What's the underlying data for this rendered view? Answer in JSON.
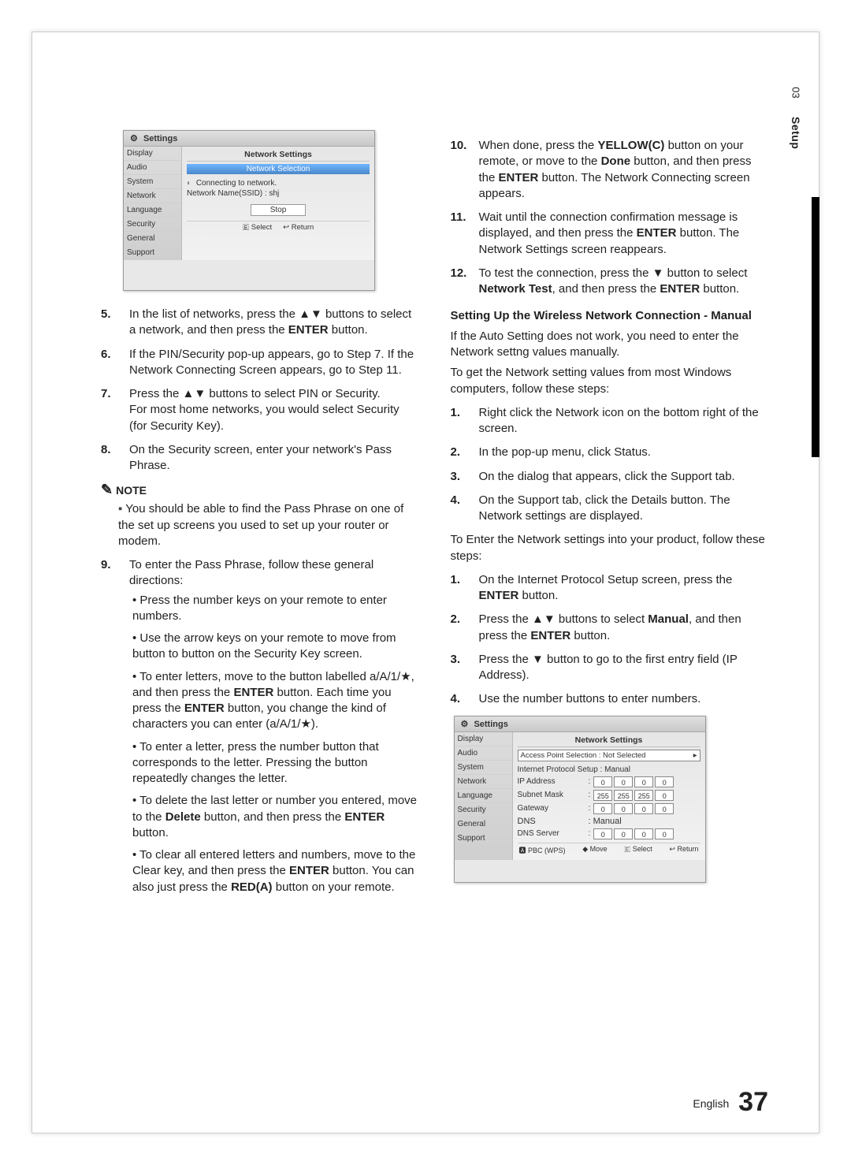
{
  "side": {
    "chapter": "03",
    "title": "Setup"
  },
  "dialog1": {
    "title": "Settings",
    "sidebar": [
      "Display",
      "Audio",
      "System",
      "Network",
      "Language",
      "Security",
      "General",
      "Support"
    ],
    "heading": "Network Settings",
    "sub": "Network Selection",
    "connecting": "Connecting to network.",
    "ssid": "Network Name(SSID)  : shj",
    "stop": "Stop",
    "hint_select": "Select",
    "hint_return": "Return"
  },
  "left_steps_a": [
    {
      "n": "5.",
      "t": "In the list of networks, press the ▲▼ buttons to select a network, and then press the <b>ENTER</b> button."
    },
    {
      "n": "6.",
      "t": "If the PIN/Security pop-up appears, go to Step 7. If the Network Connecting Screen appears, go to Step 11."
    },
    {
      "n": "7.",
      "t": "Press the ▲▼ buttons to select PIN or Security.<br>For most home networks, you would select Security (for Security Key)."
    },
    {
      "n": "8.",
      "t": "On the Security screen, enter your network's Pass Phrase."
    }
  ],
  "note_label": "NOTE",
  "note_item": "You should be able to find the Pass Phrase on one of the set up screens you used to set up your router or modem.",
  "step9": {
    "n": "9.",
    "t": "To enter the Pass Phrase, follow these general directions:"
  },
  "bullets9": [
    "Press the number keys on your remote to enter numbers.",
    "Use the arrow keys on your remote to move from button to button on the Security Key screen.",
    "To enter letters, move to the button labelled a/A/1/★, and then press the <b>ENTER</b> button. Each time you press the <b>ENTER</b> button, you change the kind of characters you can enter (a/A/1/★).",
    "To enter a letter, press the number button that corresponds to the letter. Pressing the button repeatedly changes the letter.",
    "To delete the last letter or number you entered, move to the <b>Delete</b> button, and then press the <b>ENTER</b> button.",
    "To clear all entered letters and numbers, move to the Clear key, and then press the <b>ENTER</b> button. You can also just press the <b>RED(A)</b> button on your remote."
  ],
  "right_steps_a": [
    {
      "n": "10.",
      "t": "When done, press the <b>YELLOW(C)</b> button on your remote, or move to the <b>Done</b> button, and then press the <b>ENTER</b> button. The Network Connecting screen appears."
    },
    {
      "n": "11.",
      "t": "Wait until the connection confirmation message is displayed, and then press the <b>ENTER</b> button. The Network Settings screen reappears."
    },
    {
      "n": "12.",
      "t": "To test the connection, press the ▼ button to select <b>Network Test</b>, and then press the <b>ENTER</b> button."
    }
  ],
  "section_title": "Setting Up the Wireless Network Connection - Manual",
  "para1": "If the Auto Setting does not work, you need to enter the Network settng values manually.",
  "para2": "To get the Network setting values from most Windows computers, follow these steps:",
  "right_steps_b": [
    {
      "n": "1.",
      "t": "Right click the Network icon on the bottom right of the screen."
    },
    {
      "n": "2.",
      "t": "In the pop-up menu, click Status."
    },
    {
      "n": "3.",
      "t": "On the dialog that appears, click the Support tab."
    },
    {
      "n": "4.",
      "t": "On the Support tab, click the Details button. The Network settings are displayed."
    }
  ],
  "para3": "To Enter the Network settings into your product, follow these steps:",
  "right_steps_c": [
    {
      "n": "1.",
      "t": "On the Internet Protocol Setup screen, press the <b>ENTER</b> button."
    },
    {
      "n": "2.",
      "t": "Press the ▲▼ buttons to select <b>Manual</b>, and then press the <b>ENTER</b> button."
    },
    {
      "n": "3.",
      "t": "Press the ▼ button to go to the first entry field (IP Address)."
    },
    {
      "n": "4.",
      "t": "Use the number buttons to enter numbers."
    }
  ],
  "dialog2": {
    "title": "Settings",
    "sidebar": [
      "Display",
      "Audio",
      "System",
      "Network",
      "Language",
      "Security",
      "General",
      "Support"
    ],
    "heading": "Network Settings",
    "apsel": "Access Point Selection  :  Not Selected",
    "ipsetup": "Internet Protocol Setup  : Manual",
    "rows": [
      {
        "lbl": "IP Address",
        "cells": [
          "0",
          "0",
          "0",
          "0"
        ]
      },
      {
        "lbl": "Subnet Mask",
        "cells": [
          "255",
          "255",
          "255",
          "0"
        ]
      },
      {
        "lbl": "Gateway",
        "cells": [
          "0",
          "0",
          "0",
          "0"
        ]
      }
    ],
    "dns": "DNS",
    "dns_mode": ": Manual",
    "dnsrow": {
      "lbl": "DNS Server",
      "cells": [
        "0",
        "0",
        "0",
        "0"
      ]
    },
    "hints": [
      "PBC (WPS)",
      "Move",
      "Select",
      "Return"
    ]
  },
  "footer": {
    "lang": "English",
    "page": "37"
  }
}
